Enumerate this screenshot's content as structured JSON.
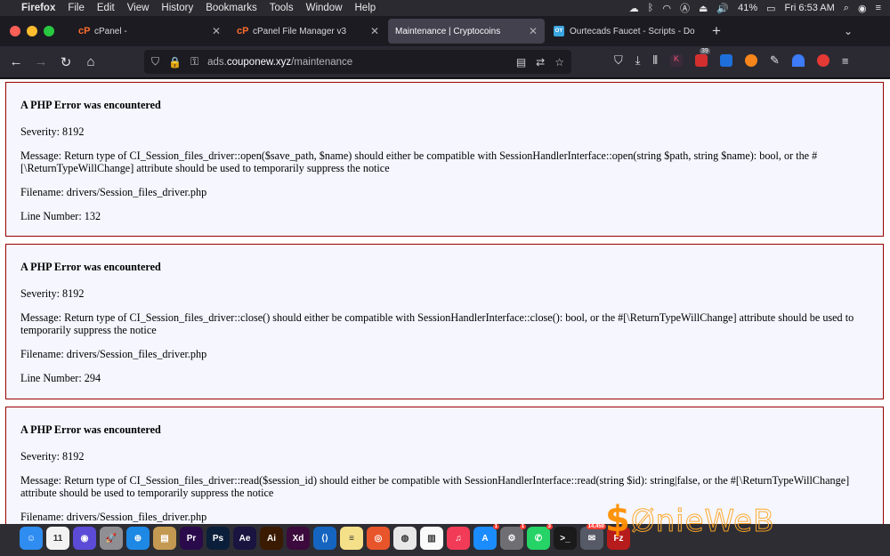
{
  "menubar": {
    "app": "Firefox",
    "items": [
      "File",
      "Edit",
      "View",
      "History",
      "Bookmarks",
      "Tools",
      "Window",
      "Help"
    ],
    "battery": "41%",
    "clock": "Fri 6:53 AM"
  },
  "tabs": [
    {
      "label": "cPanel -",
      "favicon": "cpanel-icon",
      "active": false
    },
    {
      "label": "cPanel File Manager v3",
      "favicon": "cpanel-icon",
      "active": false
    },
    {
      "label": "Maintenance | Cryptocoins",
      "favicon": "",
      "active": true
    },
    {
      "label": "Ourtecads Faucet - Scripts - Do",
      "favicon": "oy-icon",
      "active": false
    }
  ],
  "urlbar": {
    "prefix": "ads.",
    "domain": "couponew.xyz",
    "path": "/maintenance"
  },
  "toolbar": {
    "extension_badge": "39"
  },
  "errors": [
    {
      "heading": "A PHP Error was encountered",
      "severity": "Severity: 8192",
      "message": "Message: Return type of CI_Session_files_driver::open($save_path, $name) should either be compatible with SessionHandlerInterface::open(string $path, string $name): bool, or the #[\\ReturnTypeWillChange] attribute should be used to temporarily suppress the notice",
      "filename": "Filename: drivers/Session_files_driver.php",
      "line": "Line Number: 132"
    },
    {
      "heading": "A PHP Error was encountered",
      "severity": "Severity: 8192",
      "message": "Message: Return type of CI_Session_files_driver::close() should either be compatible with SessionHandlerInterface::close(): bool, or the #[\\ReturnTypeWillChange] attribute should be used to temporarily suppress the notice",
      "filename": "Filename: drivers/Session_files_driver.php",
      "line": "Line Number: 294"
    },
    {
      "heading": "A PHP Error was encountered",
      "severity": "Severity: 8192",
      "message": "Message: Return type of CI_Session_files_driver::read($session_id) should either be compatible with SessionHandlerInterface::read(string $id): string|false, or the #[\\ReturnTypeWillChange] attribute should be used to temporarily suppress the notice",
      "filename": "Filename: drivers/Session_files_driver.php",
      "line": ""
    }
  ],
  "dock": {
    "apps": [
      {
        "name": "finder-icon",
        "color": "#2f8cf0",
        "glyph": "☺"
      },
      {
        "name": "calendar-icon",
        "color": "#f2f2f2",
        "glyph": "11"
      },
      {
        "name": "siri-icon",
        "color": "#5b4bd6",
        "glyph": "◉"
      },
      {
        "name": "launchpad-icon",
        "color": "#8e8e93",
        "glyph": "🚀"
      },
      {
        "name": "safari-icon",
        "color": "#1e88e5",
        "glyph": "⊕"
      },
      {
        "name": "notes-folder-icon",
        "color": "#c49a52",
        "glyph": "▤"
      },
      {
        "name": "premiere-icon",
        "color": "#2a0a4a",
        "glyph": "Pr"
      },
      {
        "name": "photoshop-icon",
        "color": "#0b1f3a",
        "glyph": "Ps"
      },
      {
        "name": "after-effects-icon",
        "color": "#1a1440",
        "glyph": "Ae"
      },
      {
        "name": "illustrator-icon",
        "color": "#3a1a00",
        "glyph": "Ai"
      },
      {
        "name": "xd-icon",
        "color": "#3d0a3d",
        "glyph": "Xd"
      },
      {
        "name": "vscode-icon",
        "color": "#1565c0",
        "glyph": "⟨⟩"
      },
      {
        "name": "notes-icon",
        "color": "#f5e08a",
        "glyph": "≡"
      },
      {
        "name": "firefox-icon",
        "color": "#e8552b",
        "glyph": "◎"
      },
      {
        "name": "chrome-icon",
        "color": "#e8e8e8",
        "glyph": "◍"
      },
      {
        "name": "document-icon",
        "color": "#fafafa",
        "glyph": "▥"
      },
      {
        "name": "music-icon",
        "color": "#f23b57",
        "glyph": "♫"
      },
      {
        "name": "app-store-icon",
        "color": "#1a8cff",
        "glyph": "A"
      },
      {
        "name": "settings-icon",
        "color": "#6e6e73",
        "glyph": "⚙"
      },
      {
        "name": "whatsapp-icon",
        "color": "#25d366",
        "glyph": "✆"
      },
      {
        "name": "terminal-icon",
        "color": "#1a1a1a",
        "glyph": ">_"
      },
      {
        "name": "mail-icon",
        "color": "#555a66",
        "glyph": "✉"
      },
      {
        "name": "filezilla-icon",
        "color": "#b71c1c",
        "glyph": "Fz"
      }
    ],
    "badges": {
      "app-store-icon": "1",
      "whatsapp-icon": "3",
      "settings-icon": "1",
      "mail-icon": "14,450"
    }
  }
}
